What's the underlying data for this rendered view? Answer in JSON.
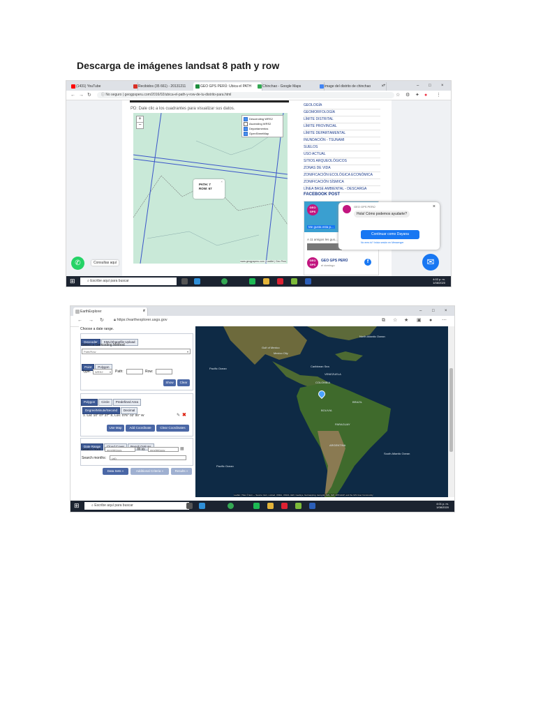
{
  "doc": {
    "title": "Descarga de imágenes landsat 8 path y row"
  },
  "shot1": {
    "tabs": [
      {
        "label": "(1431) YouTube",
        "color": "#ff0000"
      },
      {
        "label": "Recibidos (35 661) - 20131211",
        "color": "#d93025"
      },
      {
        "label": "GEO GPS PERÚ: Ubica el PATH",
        "color": "#1e8e3e"
      },
      {
        "label": "Chinchao - Google Maps",
        "color": "#34a853"
      },
      {
        "label": "image del distrito de chinchao",
        "color": "#4285f4"
      }
    ],
    "url_prefix": "No seguro",
    "url": "geogpsperu.com/2016/02/ubica-el-path-y-row-de-tu-distrito-para.html",
    "pd_text": "PD: Dale clic a los cuadrantes para visualizar sus datos.",
    "zoom_in": "+",
    "zoom_out": "−",
    "layers": [
      {
        "label": "Descending WRS2",
        "checked": true
      },
      {
        "label": "Ascending WRS2",
        "checked": false
      },
      {
        "label": "Departamentos",
        "checked": true
      },
      {
        "label": "OpenStreetMap",
        "checked": true
      }
    ],
    "popup": {
      "path": "PATH: 7",
      "row": "ROW: 67",
      "close": "×"
    },
    "map_attrib": "www.geogpsperu.com | Leaflet | Geo Perú",
    "categories": [
      "GEOLOGÍA",
      "GEOMORFOLOGÍA",
      "LÍMITE DISTRITAL",
      "LÍMITE PROVINCIAL",
      "LÍMITE DEPARTAMENTAL",
      "INUNDACIÓN - TSUNAMI",
      "SUELOS",
      "USO ACTUAL",
      "SITIOS ARQUEOLÓGICOS",
      "ZONAS DE VIDA",
      "ZONIFICACIÓN ECOLÓGICA ECONÓMICA",
      "ZONIFICACIÓN SÍSMICA",
      "LÍNEA BASE AMBIENTAL - DESCARGA"
    ],
    "fb_title": "FACEBOOK POST",
    "fb_page": "GEO GPS PERÚ",
    "fb_like": "Me gusta esta p...",
    "fb_friends": "A 11 amigos les gus...",
    "fb_footer_name": "GEO GPS PERÚ",
    "fb_footer_sub": "el domingo",
    "logo_text": "GEO GPS",
    "chat": {
      "page": "GEO GPS PERÚ",
      "greeting": "Hola! Cómo podemos ayudarte?",
      "button": "Continuar como Dayana",
      "note": "No eres tú? Inicia sesión en Messenger"
    },
    "whatsapp_label": "Consultas aquí",
    "taskbar_search": "Escribe aquí para buscar",
    "clock_time": "4:02 p. m.",
    "clock_date": "1/08/2020"
  },
  "shot2": {
    "tab": "EarthExplorer",
    "url": "https://earthexplorer.usgs.gov",
    "choose_date": "Choose a date range.",
    "geo_tabs": [
      "Geocoder",
      "KML/Shapefile Upload"
    ],
    "method_label": "Select a Geocoding Method",
    "method_value": "Path/Row",
    "pr_tabs": [
      "Point",
      "Polygon"
    ],
    "type_label": "Type:",
    "type_value": "WRS2",
    "path_label": "Path:",
    "row_label": "Row:",
    "show_btn": "Show",
    "clear_btn": "Clear",
    "area_tabs": [
      "Polygon",
      "Circle",
      "Predefined Area"
    ],
    "coord_tabs": [
      "Degree/Minute/Second",
      "Decimal"
    ],
    "coord_entry": "1.  Lat: 10° 07' 27\" S, Lon: 076° 02' 00\" W",
    "use_map": "Use Map",
    "add_coord": "Add Coordinate",
    "clear_coords": "Clear Coordinates",
    "range_tabs": [
      "Date Range",
      "Cloud Cover",
      "Result Options"
    ],
    "search_from": "Search from:",
    "date_placeholder": "mm/dd/yyyy",
    "to_label": "to:",
    "search_months": "Search months:",
    "months_value": "(all)",
    "btn_datasets": "Data Sets »",
    "btn_criteria": "Additional Criteria »",
    "btn_results": "Results »",
    "map_labels": [
      {
        "text": "Gulf of Mexico",
        "cls": "l1"
      },
      {
        "text": "Mexico City",
        "cls": "l2"
      },
      {
        "text": "North Atlantic Ocean",
        "cls": "l3"
      },
      {
        "text": "Pacific Ocean",
        "cls": "l4"
      },
      {
        "text": "Caribbean Sea",
        "cls": "l5"
      },
      {
        "text": "VENEZUELA",
        "cls": "l6"
      },
      {
        "text": "COLOMBIA",
        "cls": "l7"
      },
      {
        "text": "BRAZIL",
        "cls": "l8"
      },
      {
        "text": "BOLIVIA",
        "cls": "l9"
      },
      {
        "text": "PARAGUAY",
        "cls": "l10"
      },
      {
        "text": "ARGENTINA",
        "cls": "l11"
      },
      {
        "text": "South Atlantic Ocean",
        "cls": "l12"
      },
      {
        "text": "Pacific Ocean",
        "cls": "l13"
      }
    ],
    "map_attrib": "Leaflet | Tiles © Esri — Source: Esri, i-cubed, USDA, USGS, AEX, GeoEye, Getmapping, Aerogrid, IGN, IGP, UPR-EGP, and the GIS User Community",
    "taskbar_search": "Escribe aquí para buscar",
    "clock_time": "4:01 p. m.",
    "clock_date": "1/08/2020"
  }
}
